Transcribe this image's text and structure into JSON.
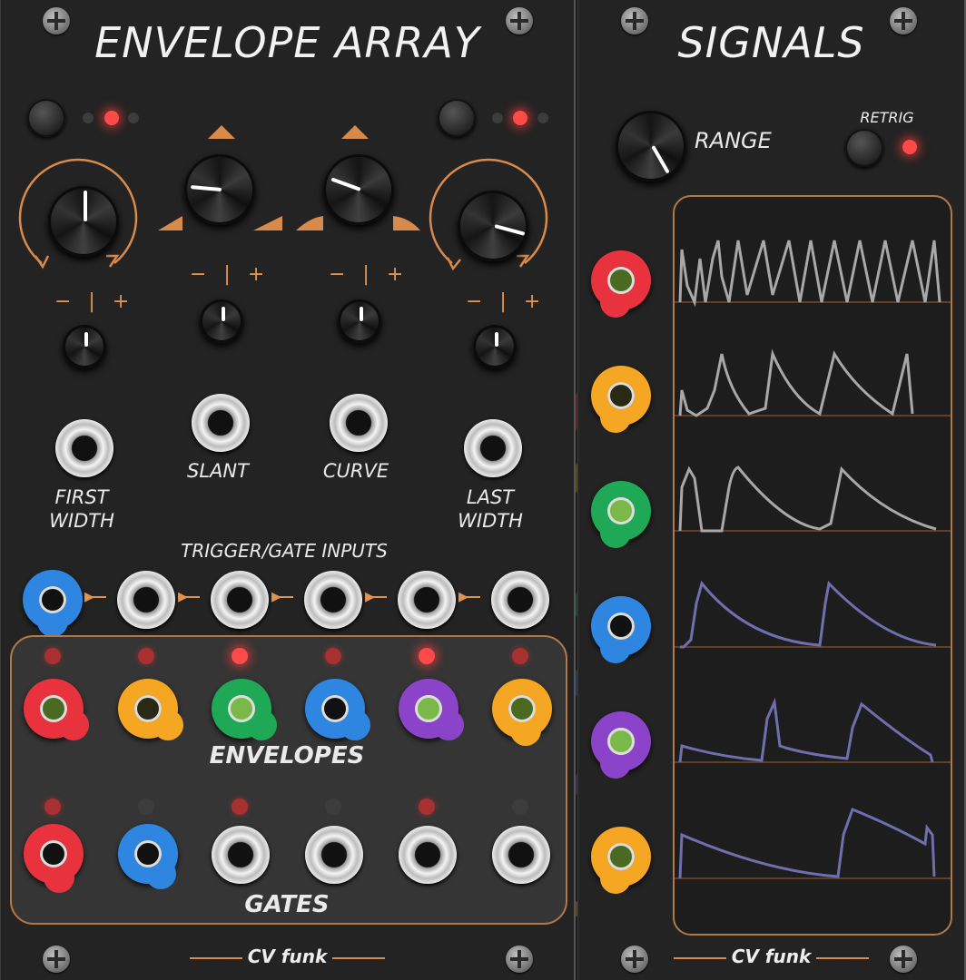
{
  "envelope_array": {
    "title": "ENVELOPE ARRAY",
    "labels": {
      "first_width": "FIRST WIDTH",
      "slant": "SLANT",
      "curve": "CURVE",
      "last_width": "LAST WIDTH",
      "trigger_gate_inputs": "TRIGGER/GATE INPUTS",
      "envelopes": "ENVELOPES",
      "gates": "GATES"
    },
    "attenuverter_sign": "− | +",
    "brand": "CV funk",
    "led_states": {
      "left_group": [
        "dim",
        "on",
        "dim"
      ],
      "right_group": [
        "dim",
        "on",
        "dim"
      ],
      "envelope_leds": [
        "mid",
        "mid",
        "on",
        "mid",
        "on",
        "mid"
      ],
      "gate_leds": [
        "mid",
        "dim",
        "mid",
        "dim",
        "mid",
        "dim"
      ]
    }
  },
  "signals": {
    "title": "SIGNALS",
    "range_label": "RANGE",
    "retrig_label": "RETRIG",
    "brand": "CV funk",
    "input_colors": [
      "#e8323d",
      "#f5a623",
      "#1fa855",
      "#2f86e0",
      "#8b44c9",
      "#f5a623"
    ],
    "trace_colors": [
      "#a8a8a8",
      "#a8a8a8",
      "#a8a8a8",
      "#6f6fb0",
      "#6f6fb0",
      "#6f6fb0"
    ]
  },
  "accent_color": "#e0934f"
}
